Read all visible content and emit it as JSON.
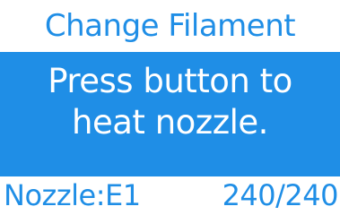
{
  "header": {
    "title": "Change Filament"
  },
  "message": {
    "line1": "Press button to",
    "line2": "heat nozzle."
  },
  "status": {
    "nozzle_label": "Nozzle:E1",
    "temperature": "240/240"
  },
  "colors": {
    "accent": "#1f8ee6",
    "background": "#ffffff",
    "text_on_accent": "#ffffff"
  }
}
